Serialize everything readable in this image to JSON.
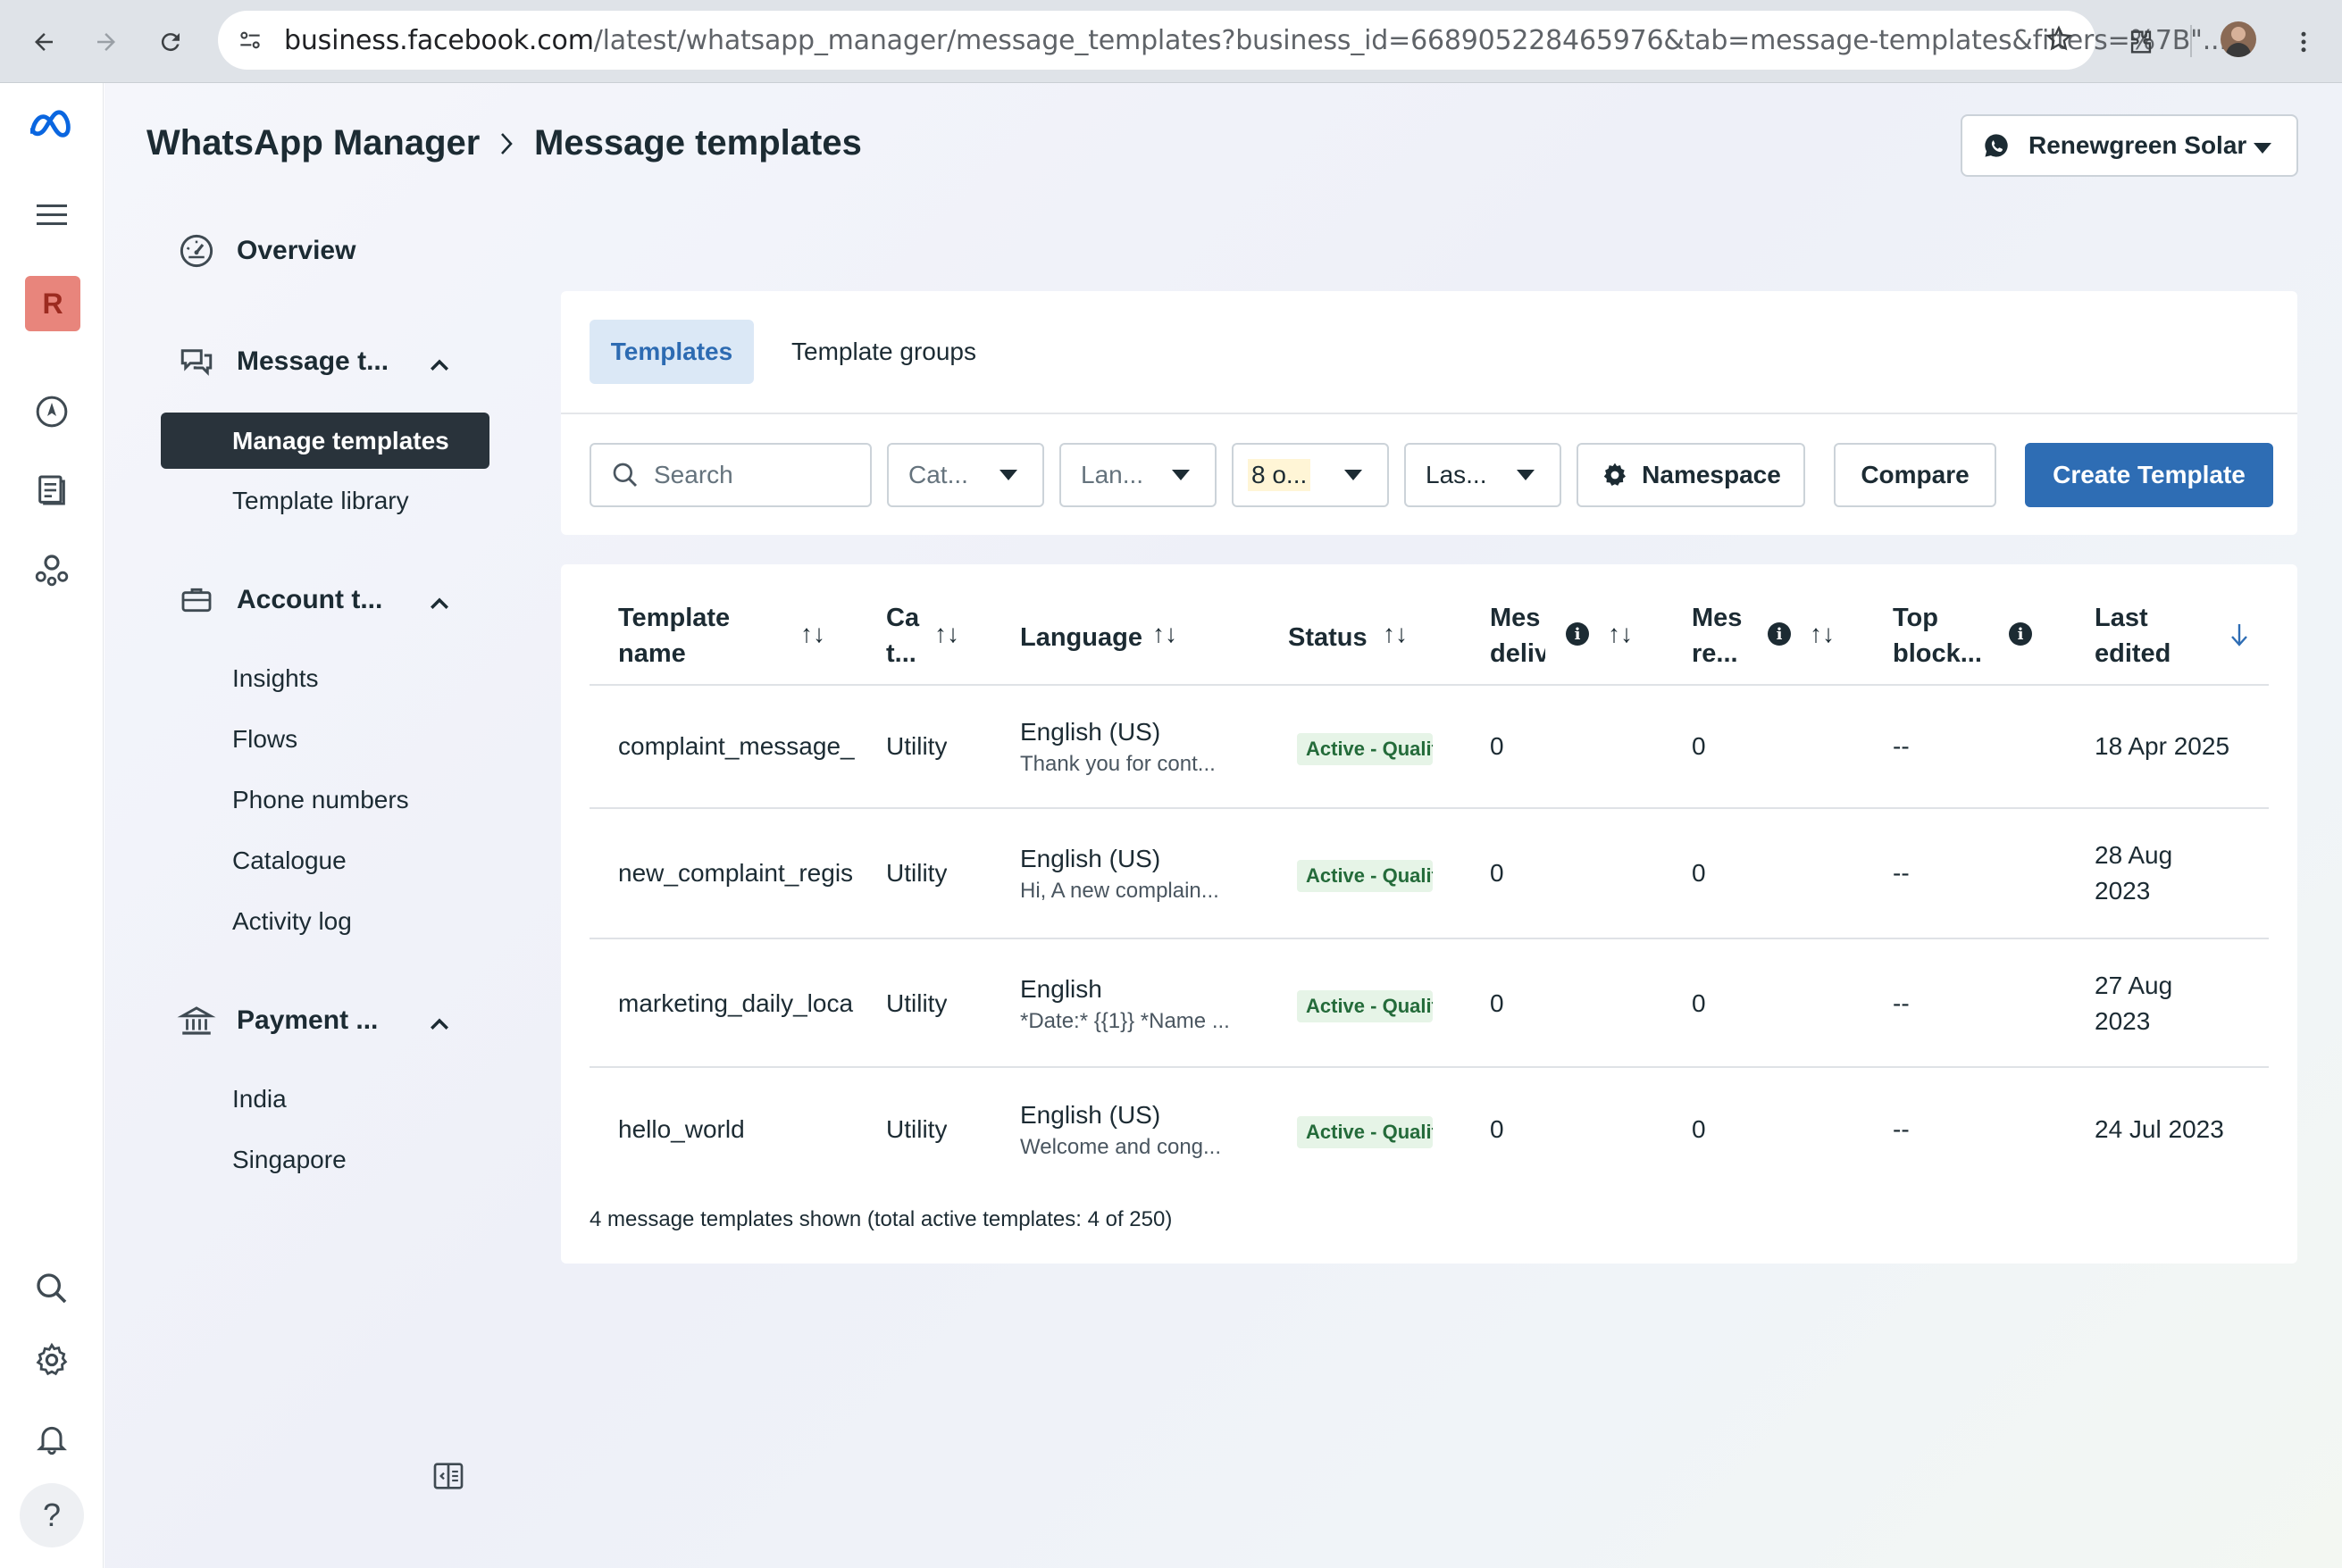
{
  "browser": {
    "url_host": "business.facebook.com",
    "url_path": "/latest/whatsapp_manager/message_templates?business_id=668905228465976&tab=message-templates&filters=%7B\"..."
  },
  "rail": {
    "avatar_letter": "R",
    "avatar_color": "#e8857c"
  },
  "header": {
    "breadcrumb_root": "WhatsApp Manager",
    "breadcrumb_current": "Message templates",
    "business_name": "Renewgreen Solar"
  },
  "sidebar": {
    "overview": "Overview",
    "message_section": "Message t...",
    "message_items": [
      "Manage templates",
      "Template library"
    ],
    "account_section": "Account t...",
    "account_items": [
      "Insights",
      "Flows",
      "Phone numbers",
      "Catalogue",
      "Activity log"
    ],
    "payment_section": "Payment ...",
    "payment_items": [
      "India",
      "Singapore"
    ]
  },
  "tabs": [
    "Templates",
    "Template groups"
  ],
  "filters": {
    "search_placeholder": "Search",
    "category": "Cat...",
    "language": "Lan...",
    "status": "8 o...",
    "last": "Las...",
    "namespace": "Namespace",
    "compare": "Compare",
    "create": "Create Template"
  },
  "table": {
    "headers": {
      "name_1": "Template",
      "name_2": "name",
      "cat_1": "Ca",
      "cat_2": "t...",
      "language": "Language",
      "status": "Status",
      "delivered_1": "Mes",
      "delivered_2": "deliv",
      "read_1": "Mes",
      "read_2": "re...",
      "block_1": "Top",
      "block_2": "block...",
      "edited_1": "Last",
      "edited_2": "edited"
    },
    "rows": [
      {
        "name": "complaint_message_",
        "category": "Utility",
        "language": "English (US)",
        "preview": "Thank you for cont...",
        "status": "Active - Quality pending",
        "delivered": "0",
        "read": "0",
        "block": "--",
        "edited_1": "18 Apr 2025",
        "edited_2": ""
      },
      {
        "name": "new_complaint_regis",
        "category": "Utility",
        "language": "English (US)",
        "preview": "Hi, A new complain...",
        "status": "Active - Quality pending",
        "delivered": "0",
        "read": "0",
        "block": "--",
        "edited_1": "28 Aug",
        "edited_2": "2023"
      },
      {
        "name": "marketing_daily_loca",
        "category": "Utility",
        "language": "English",
        "preview": "*Date:* {{1}} *Name ...",
        "status": "Active - Quality pending",
        "delivered": "0",
        "read": "0",
        "block": "--",
        "edited_1": "27 Aug",
        "edited_2": "2023"
      },
      {
        "name": "hello_world",
        "category": "Utility",
        "language": "English (US)",
        "preview": "Welcome and cong...",
        "status": "Active - Quality pending",
        "delivered": "0",
        "read": "0",
        "block": "--",
        "edited_1": "24 Jul 2023",
        "edited_2": ""
      }
    ],
    "footer": "4 message templates shown (total active templates: 4 of 250)"
  },
  "colors": {
    "primary": "#2e6db4",
    "active_nav": "#29333b",
    "badge_bg": "#e6f4e7",
    "badge_text": "#246b3a"
  }
}
